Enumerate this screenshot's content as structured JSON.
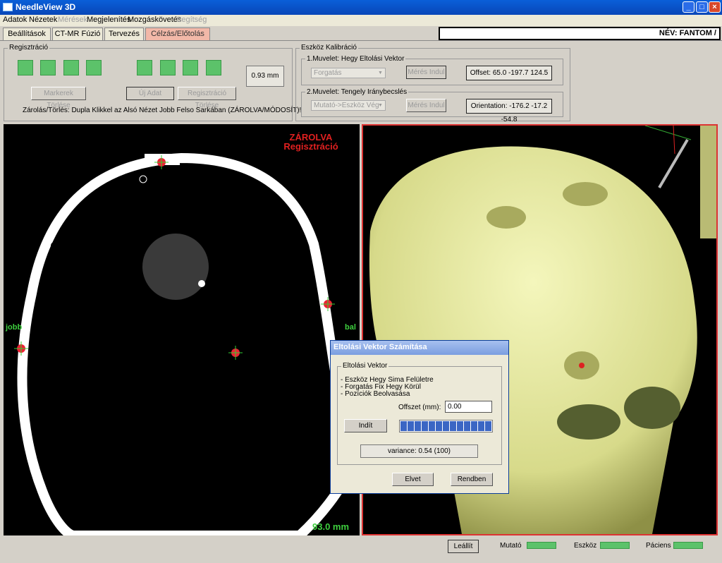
{
  "window": {
    "title": "NeedleView 3D"
  },
  "menu": {
    "items": [
      "Adatok",
      "Nézetek",
      "Mérések",
      "Megjelenítés",
      "Mozgáskövetés",
      "Segítség"
    ]
  },
  "tabs": [
    "Beállítások",
    "CT-MR Fúzió",
    "Tervezés",
    "Célzás/Előtolás"
  ],
  "name_field": "NÉV:  FANTOM /",
  "registration": {
    "title": "Regisztráció",
    "distance": "0.93 mm",
    "btn_clear_markers": "Markerek Törlése",
    "btn_new_data": "Új Adat",
    "btn_clear_reg": "Regisztráció Törlése",
    "hint": "Zárolás/Törlés: Dupla Klikkel az Alsó Nézet Jobb Felso Sarkában (ZÁROLVA/MÓDOSÍT)!"
  },
  "calibration": {
    "title": "Eszköz Kalibráció",
    "op1_title": "1.Muvelet: Hegy Eltolási Vektor",
    "op1_select": "Forgatás",
    "op1_button": "Mérés Indul",
    "op1_value": "Offset: 65.0 -197.7 124.5",
    "op2_title": "2.Muvelet: Tengely Iránybecslés",
    "op2_select": "Mutató->Eszköz Vég",
    "op2_button": "Mérés Indul",
    "op2_value": "Orientation: -176.2 -17.2 -54.8"
  },
  "left_view": {
    "locked": "ZÁROLVA",
    "sub": "Regisztráció",
    "left_label": "jobb",
    "right_label": "bal",
    "measure": "93.0 mm"
  },
  "dialog": {
    "title": "Eltolási Vektor Számítása",
    "group": "Eltolási Vektor",
    "steps": [
      "- Eszköz Hegy Sima Felületre",
      "- Forgatás Fix Hegy Körül",
      "- Pozíciók Beolvasása"
    ],
    "offset_label": "Offszet (mm):",
    "offset_value": "0.00",
    "start": "Indít",
    "progress_segments": 13,
    "variance": "variance: 0.54 (100)",
    "cancel": "Elvet",
    "ok": "Rendben"
  },
  "status": {
    "stop": "Leállít",
    "ind1": "Mutató",
    "ind2": "Eszköz",
    "ind3": "Páciens"
  },
  "colors": {
    "indicator": "#5cc26a",
    "accent_red": "#e02020",
    "label_green": "#3ecf3e",
    "skull": "#e8eaa0"
  }
}
